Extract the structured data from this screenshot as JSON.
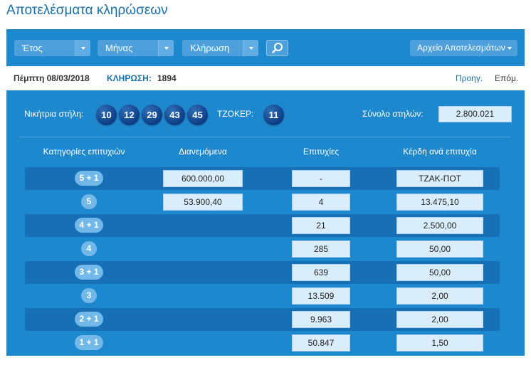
{
  "page": {
    "title": "Αποτελέσματα κληρώσεων"
  },
  "toolbar": {
    "year_label": "Έτος",
    "month_label": "Μήνας",
    "draw_label": "Κλήρωση",
    "archive_label": "Αρχείο Αποτελεσμάτων"
  },
  "info": {
    "date": "Πέμπτη 08/03/2018",
    "draw_label": "ΚΛΗΡΩΣΗ:",
    "draw_number": "1894",
    "prev": "Προηγ.",
    "next": "Επόμ."
  },
  "result": {
    "winning_label": "Νικήτρια στήλη:",
    "numbers": [
      "10",
      "12",
      "29",
      "43",
      "45"
    ],
    "joker_label": "ΤΖΟΚΕΡ:",
    "joker": "11",
    "total_label": "Σύνολο στηλών:",
    "total": "2.800.021"
  },
  "table": {
    "headers": [
      "Κατηγορίες επιτυχιών",
      "Διανεμόμενα",
      "Επιτυχίες",
      "Κέρδη ανά επιτυχία"
    ],
    "rows": [
      {
        "category": "5 + 1",
        "distributed": "600.000,00",
        "winners": "-",
        "prize": "ΤΖΑΚ-ΠΟΤ"
      },
      {
        "category": "5",
        "distributed": "53.900,40",
        "winners": "4",
        "prize": "13.475,10"
      },
      {
        "category": "4 + 1",
        "distributed": "",
        "winners": "21",
        "prize": "2.500,00"
      },
      {
        "category": "4",
        "distributed": "",
        "winners": "285",
        "prize": "50,00"
      },
      {
        "category": "3 + 1",
        "distributed": "",
        "winners": "639",
        "prize": "50,00"
      },
      {
        "category": "3",
        "distributed": "",
        "winners": "13.509",
        "prize": "2,00"
      },
      {
        "category": "2 + 1",
        "distributed": "",
        "winners": "9.963",
        "prize": "2,00"
      },
      {
        "category": "1 + 1",
        "distributed": "",
        "winners": "50.847",
        "prize": "1,50"
      }
    ]
  },
  "colors": {
    "panel": "#1e88cf",
    "row_dark": "#1770b6",
    "cell_bg": "#d9eefa",
    "ball": "#0c3d85",
    "title": "#1a6fa8"
  }
}
